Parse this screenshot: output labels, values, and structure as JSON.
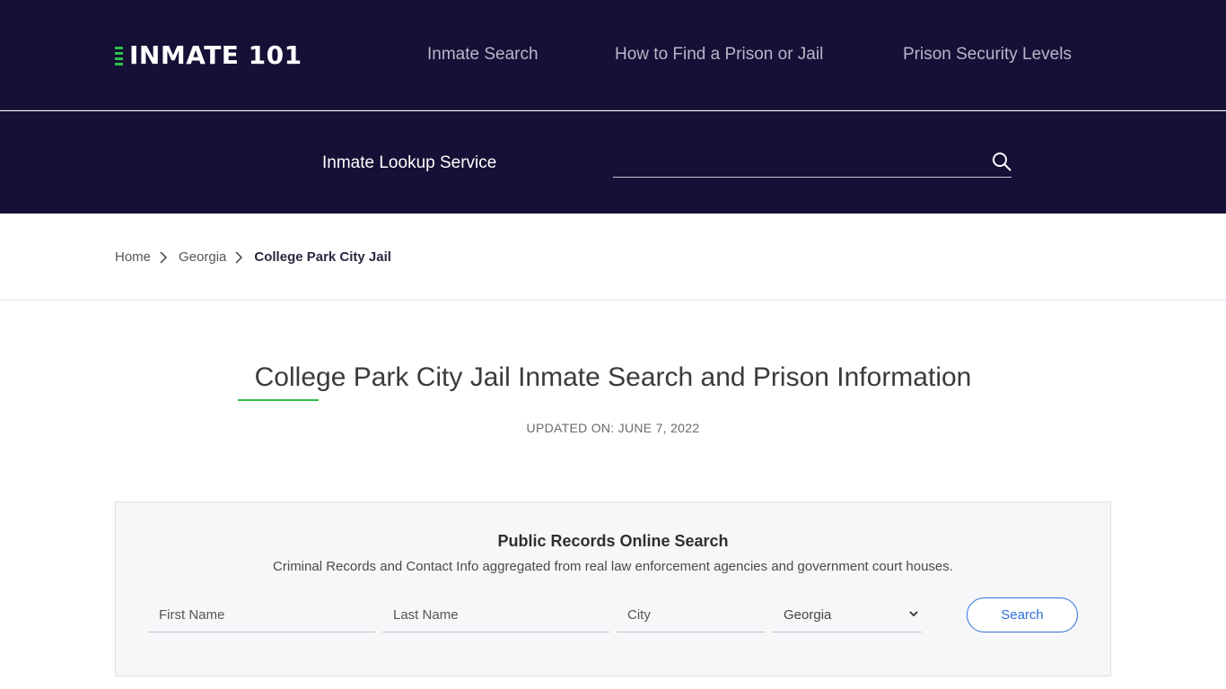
{
  "brand": {
    "logo_text": "INMATE 101",
    "accent_color": "#2fbf4a",
    "header_bg": "#160f36"
  },
  "nav": {
    "items": [
      {
        "label": "Inmate Search"
      },
      {
        "label": "How to Find a Prison or Jail"
      },
      {
        "label": "Prison Security Levels"
      }
    ]
  },
  "lookup": {
    "label": "Inmate Lookup Service",
    "value": "",
    "icon": "search-icon"
  },
  "breadcrumb": {
    "items": [
      {
        "label": "Home"
      },
      {
        "label": "Georgia"
      },
      {
        "label": "College Park City Jail"
      }
    ]
  },
  "page": {
    "title": "College Park City Jail Inmate Search and Prison Information",
    "updated": "UPDATED ON: JUNE 7, 2022"
  },
  "records_search": {
    "title": "Public Records Online Search",
    "subtitle": "Criminal Records and Contact Info aggregated from real law enforcement agencies and government court houses.",
    "first_name_placeholder": "First Name",
    "last_name_placeholder": "Last Name",
    "city_placeholder": "City",
    "state_selected": "Georgia",
    "button_label": "Search",
    "button_color": "#2f6fd6"
  }
}
